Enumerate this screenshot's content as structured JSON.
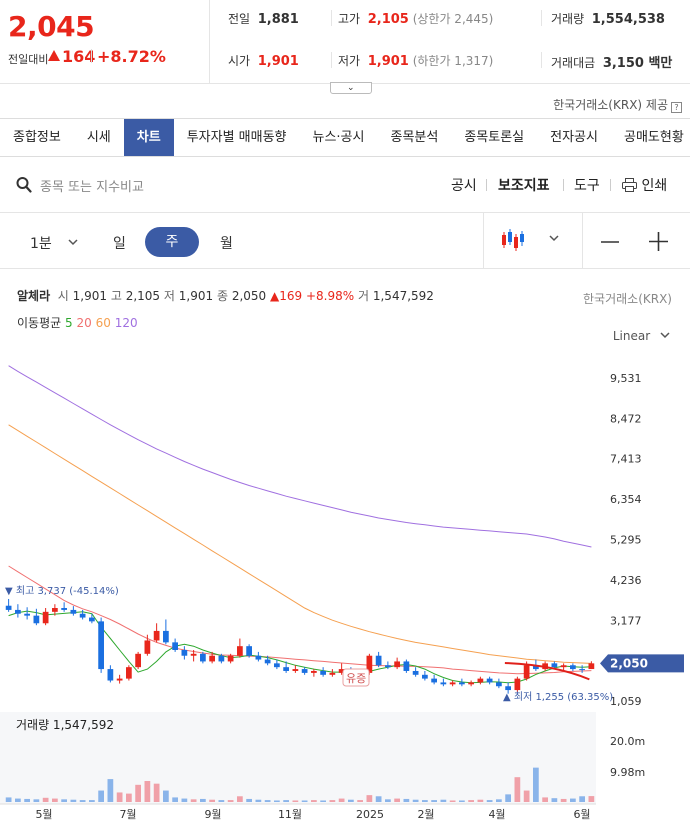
{
  "quote": {
    "price": "2,045",
    "change_label": "전일대비",
    "change": "164",
    "change_pct": "+8.72%",
    "prev_close_label": "전일",
    "prev_close": "1,881",
    "high_label": "고가",
    "high": "2,105",
    "upper_limit": "(상한가 2,445)",
    "volume_label": "거래량",
    "volume": "1,554,538",
    "open_label": "시가",
    "open": "1,901",
    "low_label": "저가",
    "low": "1,901",
    "lower_limit": "(하한가 1,317)",
    "amount_label": "거래대금",
    "amount": "3,150 백만",
    "expand_icon": "chevron-down-icon"
  },
  "source": "한국거래소(KRX) 제공",
  "tabs": [
    "종합정보",
    "시세",
    "차트",
    "투자자별 매매동향",
    "뉴스·공시",
    "종목분석",
    "종목토론실",
    "전자공시",
    "공매도현황"
  ],
  "active_tab": 2,
  "toolbar": {
    "search_placeholder": "종목 또는 지수비교",
    "disclosure": "공시",
    "indicators": "보조지표",
    "tools": "도구",
    "print": "인쇄"
  },
  "period": {
    "minute": "1분",
    "day": "일",
    "week": "주",
    "month": "월"
  },
  "chart_header": {
    "name": "알체라",
    "open_label": "시",
    "open": "1,901",
    "high_label": "고",
    "high": "2,105",
    "low_label": "저",
    "low": "1,901",
    "close_label": "종",
    "close": "2,050",
    "change": "169 +8.98%",
    "volume_label": "거",
    "volume": "1,547,592",
    "exchange": "한국거래소(KRX)",
    "ma_label": "이동평균",
    "ma": [
      "5",
      "20",
      "60",
      "120"
    ],
    "scale": "Linear"
  },
  "colors": {
    "up": "#e8261b",
    "down": "#1a6fe0",
    "accent": "#3b5ba5",
    "ma5": "#2ea82e",
    "ma20": "#f07070",
    "ma60": "#f5a050",
    "ma120": "#a070e0"
  },
  "chart_data": {
    "type": "candlestick",
    "title": "",
    "x_ticks": [
      "5월",
      "7월",
      "9월",
      "11월",
      "2025",
      "2월",
      "4월",
      "6월"
    ],
    "y_ticks": [
      9531,
      8472,
      7413,
      6354,
      5295,
      4236,
      3177,
      1059
    ],
    "ylim": [
      880,
      10130
    ],
    "current_price_label": "2,050",
    "max_label": "최고 3,737 (-45.14%)",
    "min_label": "최저 1,255 (63.35%)",
    "event_label": "유증",
    "weekly_candles": [
      {
        "o": 3560,
        "h": 3737,
        "l": 3400,
        "c": 3450
      },
      {
        "o": 3450,
        "h": 3600,
        "l": 3250,
        "c": 3350
      },
      {
        "o": 3350,
        "h": 3520,
        "l": 3200,
        "c": 3300
      },
      {
        "o": 3300,
        "h": 3480,
        "l": 3050,
        "c": 3100
      },
      {
        "o": 3100,
        "h": 3500,
        "l": 3050,
        "c": 3400
      },
      {
        "o": 3400,
        "h": 3600,
        "l": 3300,
        "c": 3500
      },
      {
        "o": 3500,
        "h": 3650,
        "l": 3400,
        "c": 3450
      },
      {
        "o": 3450,
        "h": 3550,
        "l": 3300,
        "c": 3350
      },
      {
        "o": 3350,
        "h": 3450,
        "l": 3200,
        "c": 3250
      },
      {
        "o": 3250,
        "h": 3350,
        "l": 3100,
        "c": 3150
      },
      {
        "o": 3150,
        "h": 3250,
        "l": 1800,
        "c": 1900
      },
      {
        "o": 1900,
        "h": 2000,
        "l": 1550,
        "c": 1600
      },
      {
        "o": 1600,
        "h": 1750,
        "l": 1520,
        "c": 1650
      },
      {
        "o": 1650,
        "h": 2000,
        "l": 1600,
        "c": 1950
      },
      {
        "o": 1950,
        "h": 2350,
        "l": 1900,
        "c": 2300
      },
      {
        "o": 2300,
        "h": 2800,
        "l": 2250,
        "c": 2650
      },
      {
        "o": 2650,
        "h": 3100,
        "l": 2600,
        "c": 2900
      },
      {
        "o": 2900,
        "h": 3200,
        "l": 2550,
        "c": 2600
      },
      {
        "o": 2600,
        "h": 2700,
        "l": 2350,
        "c": 2400
      },
      {
        "o": 2400,
        "h": 2500,
        "l": 2150,
        "c": 2250
      },
      {
        "o": 2250,
        "h": 2400,
        "l": 2100,
        "c": 2300
      },
      {
        "o": 2300,
        "h": 2350,
        "l": 2050,
        "c": 2100
      },
      {
        "o": 2100,
        "h": 2350,
        "l": 2050,
        "c": 2250
      },
      {
        "o": 2250,
        "h": 2300,
        "l": 2050,
        "c": 2100
      },
      {
        "o": 2100,
        "h": 2300,
        "l": 2050,
        "c": 2250
      },
      {
        "o": 2250,
        "h": 2700,
        "l": 2200,
        "c": 2500
      },
      {
        "o": 2500,
        "h": 2550,
        "l": 2200,
        "c": 2250
      },
      {
        "o": 2250,
        "h": 2350,
        "l": 2100,
        "c": 2150
      },
      {
        "o": 2150,
        "h": 2250,
        "l": 2000,
        "c": 2050
      },
      {
        "o": 2050,
        "h": 2150,
        "l": 1900,
        "c": 1950
      },
      {
        "o": 1950,
        "h": 2100,
        "l": 1800,
        "c": 1850
      },
      {
        "o": 1850,
        "h": 2000,
        "l": 1800,
        "c": 1900
      },
      {
        "o": 1900,
        "h": 1950,
        "l": 1750,
        "c": 1800
      },
      {
        "o": 1800,
        "h": 1900,
        "l": 1700,
        "c": 1850
      },
      {
        "o": 1850,
        "h": 1950,
        "l": 1700,
        "c": 1750
      },
      {
        "o": 1750,
        "h": 1900,
        "l": 1700,
        "c": 1800
      },
      {
        "o": 1800,
        "h": 2050,
        "l": 1750,
        "c": 1900
      },
      {
        "o": 1900,
        "h": 1950,
        "l": 1700,
        "c": 1750
      },
      {
        "o": 1750,
        "h": 1850,
        "l": 1700,
        "c": 1800
      },
      {
        "o": 1800,
        "h": 2300,
        "l": 1750,
        "c": 2250
      },
      {
        "o": 2250,
        "h": 2350,
        "l": 1950,
        "c": 2000
      },
      {
        "o": 2000,
        "h": 2100,
        "l": 1900,
        "c": 1950
      },
      {
        "o": 1950,
        "h": 2200,
        "l": 1900,
        "c": 2100
      },
      {
        "o": 2100,
        "h": 2150,
        "l": 1800,
        "c": 1850
      },
      {
        "o": 1850,
        "h": 1950,
        "l": 1700,
        "c": 1750
      },
      {
        "o": 1750,
        "h": 1850,
        "l": 1600,
        "c": 1650
      },
      {
        "o": 1650,
        "h": 1750,
        "l": 1500,
        "c": 1550
      },
      {
        "o": 1550,
        "h": 1650,
        "l": 1450,
        "c": 1500
      },
      {
        "o": 1500,
        "h": 1600,
        "l": 1450,
        "c": 1550
      },
      {
        "o": 1550,
        "h": 1650,
        "l": 1450,
        "c": 1500
      },
      {
        "o": 1500,
        "h": 1600,
        "l": 1450,
        "c": 1550
      },
      {
        "o": 1550,
        "h": 1700,
        "l": 1500,
        "c": 1650
      },
      {
        "o": 1650,
        "h": 1700,
        "l": 1500,
        "c": 1550
      },
      {
        "o": 1550,
        "h": 1650,
        "l": 1400,
        "c": 1450
      },
      {
        "o": 1450,
        "h": 1550,
        "l": 1255,
        "c": 1350
      },
      {
        "o": 1350,
        "h": 1700,
        "l": 1300,
        "c": 1650
      },
      {
        "o": 1650,
        "h": 2100,
        "l": 1600,
        "c": 2000
      },
      {
        "o": 2000,
        "h": 2150,
        "l": 1850,
        "c": 1900
      },
      {
        "o": 1900,
        "h": 2100,
        "l": 1850,
        "c": 2050
      },
      {
        "o": 2050,
        "h": 2100,
        "l": 1900,
        "c": 1950
      },
      {
        "o": 1950,
        "h": 2050,
        "l": 1850,
        "c": 2000
      },
      {
        "o": 2000,
        "h": 2050,
        "l": 1850,
        "c": 1900
      },
      {
        "o": 1900,
        "h": 2000,
        "l": 1800,
        "c": 1881
      },
      {
        "o": 1901,
        "h": 2105,
        "l": 1901,
        "c": 2050
      }
    ],
    "volume_label": "거래량 1,547,592",
    "volume_ticks": [
      "20.0m",
      "9.98m"
    ],
    "volume_max": 22000000,
    "weekly_volume": [
      1200000,
      900000,
      800000,
      700000,
      1100000,
      900000,
      700000,
      600000,
      500000,
      500000,
      3000000,
      6000000,
      2500000,
      2200000,
      4500000,
      5500000,
      4800000,
      3000000,
      1200000,
      900000,
      700000,
      800000,
      600000,
      500000,
      500000,
      1500000,
      800000,
      600000,
      500000,
      400000,
      500000,
      400000,
      400000,
      500000,
      400000,
      500000,
      900000,
      600000,
      500000,
      1800000,
      1500000,
      700000,
      900000,
      800000,
      600000,
      500000,
      500000,
      600000,
      400000,
      400000,
      500000,
      600000,
      500000,
      700000,
      2000000,
      6500000,
      3000000,
      9000000,
      1200000,
      1000000,
      800000,
      900000,
      1500000,
      1547592
    ],
    "ma5": [
      3300,
      3380,
      3420,
      3380,
      3320,
      3340,
      3360,
      3380,
      3400,
      3350,
      3000,
      2700,
      2400,
      2100,
      1820,
      1900,
      2100,
      2350,
      2500,
      2550,
      2500,
      2400,
      2320,
      2250,
      2200,
      2220,
      2260,
      2240,
      2200,
      2140,
      2070,
      2000,
      1950,
      1900,
      1860,
      1820,
      1820,
      1830,
      1820,
      1840,
      1900,
      1950,
      2000,
      2020,
      1980,
      1900,
      1780,
      1680,
      1600,
      1560,
      1540,
      1550,
      1570,
      1560,
      1540,
      1560,
      1640,
      1760,
      1850,
      1930,
      1980,
      1960,
      1950,
      1960
    ],
    "ma20": [
      4600,
      4450,
      4300,
      4150,
      4000,
      3850,
      3700,
      3580,
      3480,
      3400,
      3300,
      3200,
      3080,
      2950,
      2820,
      2700,
      2600,
      2520,
      2450,
      2400,
      2360,
      2320,
      2290,
      2270,
      2260,
      2250,
      2240,
      2230,
      2220,
      2200,
      2180,
      2160,
      2140,
      2120,
      2100,
      2080,
      2060,
      2040,
      2020,
      2000,
      1990,
      1985,
      1980,
      1975,
      1970,
      1960,
      1950,
      1930,
      1900,
      1880,
      1860,
      1840,
      1820,
      1800,
      1790,
      1780,
      1785,
      1790,
      1800,
      1810,
      1830,
      1840,
      1850,
      1860
    ],
    "ma60": [
      8300,
      8150,
      8000,
      7850,
      7700,
      7550,
      7400,
      7250,
      7100,
      6950,
      6800,
      6650,
      6500,
      6350,
      6200,
      6050,
      5900,
      5750,
      5600,
      5450,
      5300,
      5150,
      5000,
      4850,
      4700,
      4550,
      4400,
      4250,
      4100,
      3950,
      3800,
      3650,
      3500,
      3380,
      3280,
      3180,
      3100,
      3020,
      2950,
      2880,
      2820,
      2760,
      2700,
      2650,
      2600,
      2560,
      2520,
      2480,
      2440,
      2400,
      2360,
      2320,
      2280,
      2250,
      2220,
      2190,
      2160,
      2140,
      2120,
      2100,
      2080,
      2070,
      2060,
      2050
    ],
    "ma120": [
      9850,
      9700,
      9560,
      9420,
      9280,
      9140,
      9000,
      8860,
      8720,
      8580,
      8440,
      8300,
      8170,
      8040,
      7910,
      7790,
      7670,
      7560,
      7450,
      7340,
      7240,
      7140,
      7050,
      6960,
      6870,
      6790,
      6710,
      6640,
      6570,
      6500,
      6430,
      6370,
      6310,
      6250,
      6190,
      6130,
      6070,
      6010,
      5960,
      5910,
      5860,
      5820,
      5780,
      5740,
      5710,
      5680,
      5650,
      5620,
      5600,
      5580,
      5560,
      5540,
      5520,
      5500,
      5480,
      5460,
      5440,
      5400,
      5360,
      5310,
      5250,
      5200,
      5150,
      5100
    ]
  }
}
